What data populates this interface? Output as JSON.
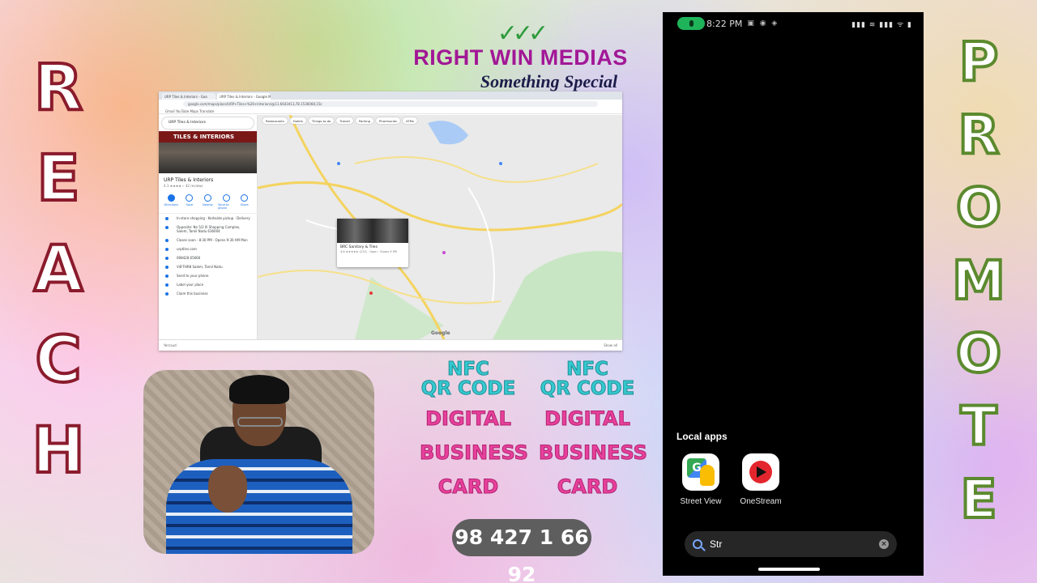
{
  "side_left": [
    "R",
    "E",
    "A",
    "C",
    "H"
  ],
  "side_right": [
    "P",
    "R",
    "O",
    "M",
    "O",
    "T",
    "E"
  ],
  "brand": {
    "title": "RIGHT WIN MEDIAS",
    "tagline": "Something Special"
  },
  "browser": {
    "tabs": [
      "URP Tiles & Interiors - Goo",
      "URP Tiles & Interiors - Google Maps"
    ],
    "url": "google.com/maps/place/URP+Tiles+%26+Interiors/@11.6643413,78.1536068,15z",
    "bookmarks": "Gmail   YouTube   Maps   Translate",
    "place": {
      "search": "URP Tiles & Interiors",
      "name": "URP Tiles & Interiors",
      "rating": "4.1 ★★★★☆ 42 reviews",
      "actions": [
        "Directions",
        "Save",
        "Nearby",
        "Send to phone",
        "Share"
      ],
      "rows": [
        "In-store shopping · Kerbside pickup · Delivery",
        "Opposite: No 5/2 Ill Shopping Complex, Salem, Tamil Nadu 636004",
        "Closes soon · 8:30 PM · Opens 9:30 AM Mon",
        "urptiles.com",
        "098428 65666",
        "V4FFHR8 Salem, Tamil Nadu",
        "Send to your phone",
        "Label your place",
        "Claim this business"
      ]
    },
    "map": {
      "chips": [
        "Restaurants",
        "Hotels",
        "Things to do",
        "Transit",
        "Parking",
        "Pharmacies",
        "ATMs"
      ],
      "card_title": "BRC Sanitary & Tiles",
      "card_sub": "4.6 ★★★★★ (213) · Open · Closes 9 PM",
      "google_label": "Google"
    },
    "footer_left": "Yercaud",
    "footer_right": "Show all"
  },
  "promo": {
    "line1": "NFC",
    "line2": "QR CODE",
    "line3": "DIGITAL",
    "line4": "BUSINESS",
    "line5": "CARD",
    "phone": "98 427 1 66 92"
  },
  "phone": {
    "time": "8:22 PM",
    "status_right": "▮▮▮ ≋ ▮▮▮ ᯤ ▮",
    "local_apps_title": "Local apps",
    "apps": [
      {
        "label": "Street View",
        "icon": "street-view-icon"
      },
      {
        "label": "OneStream",
        "icon": "onestream-icon"
      }
    ],
    "search_value": "Str"
  }
}
